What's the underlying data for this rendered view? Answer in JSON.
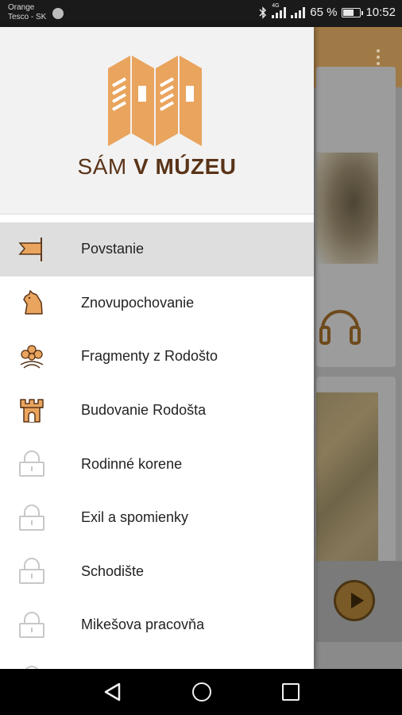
{
  "status_bar": {
    "carrier_line1": "Orange",
    "carrier_line2": "Tesco - SK",
    "battery_level": "65 %",
    "battery_fraction": 0.65,
    "network_label": "4G",
    "time": "10:52"
  },
  "drawer": {
    "logo_text_regular": "SÁM ",
    "logo_text_bold": "V MÚZEU",
    "items": [
      {
        "label": "Povstanie",
        "icon": "flag-icon",
        "active": true,
        "locked": false
      },
      {
        "label": "Znovupochovanie",
        "icon": "horse-icon",
        "active": false,
        "locked": false
      },
      {
        "label": "Fragmenty z Rodošto",
        "icon": "flower-ornament-icon",
        "active": false,
        "locked": false
      },
      {
        "label": "Budovanie Rodošta",
        "icon": "castle-tower-icon",
        "active": false,
        "locked": false
      },
      {
        "label": "Rodinné korene",
        "icon": "lock-icon",
        "active": false,
        "locked": true
      },
      {
        "label": "Exil a spomienky",
        "icon": "lock-icon",
        "active": false,
        "locked": true
      },
      {
        "label": "Schodište",
        "icon": "lock-icon",
        "active": false,
        "locked": true
      },
      {
        "label": "Mikešova pracovňa",
        "icon": "lock-icon",
        "active": false,
        "locked": true
      }
    ]
  },
  "colors": {
    "accent": "#e9a45d",
    "brand_text": "#5a3418",
    "active_item_bg": "#dedede",
    "lock_gray": "#c8c8c8"
  }
}
